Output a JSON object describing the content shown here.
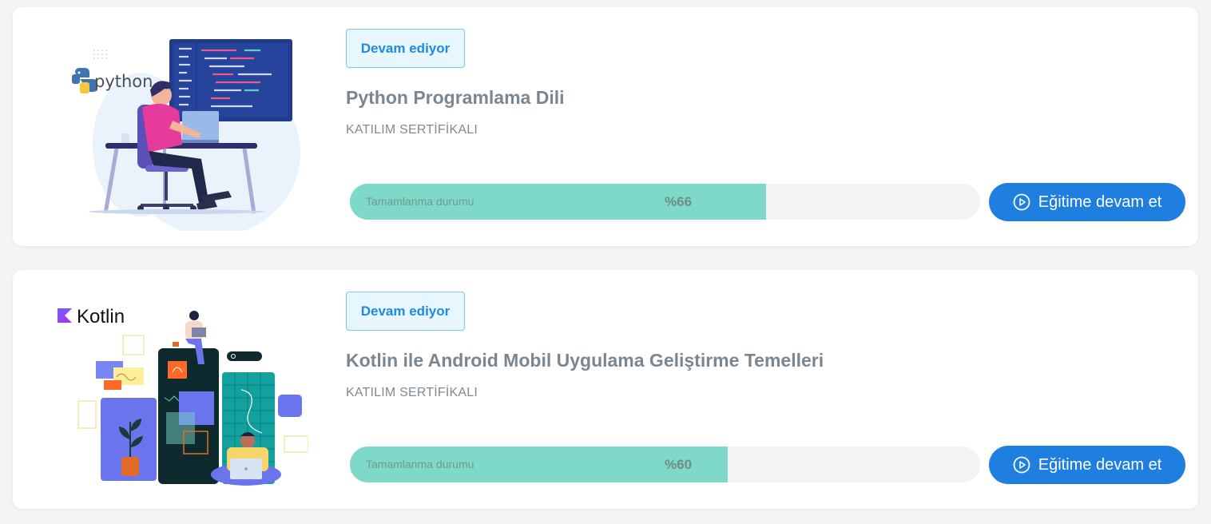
{
  "courses": [
    {
      "status_badge": "Devam ediyor",
      "title": "Python Programlama Dili",
      "certificate": "KATILIM SERTİFİKALI",
      "progress_label": "Tamamlanma durumu",
      "progress_text": "%66",
      "progress_value": 0.66,
      "cta_label": "Eğitime devam et",
      "thumbnail_logo": "python",
      "thumbnail_icon": "python-logo-icon"
    },
    {
      "status_badge": "Devam ediyor",
      "title": "Kotlin ile Android Mobil Uygulama Geliştirme Temelleri",
      "certificate": "KATILIM SERTİFİKALI",
      "progress_label": "Tamamlanma durumu",
      "progress_text": "%60",
      "progress_value": 0.6,
      "cta_label": "Eğitime devam et",
      "thumbnail_logo": "Kotlin",
      "thumbnail_icon": "kotlin-logo-icon"
    }
  ],
  "colors": {
    "badge_text": "#1f8be0",
    "badge_bg": "#e8f6fd",
    "progress_fill": "#7ed9c8",
    "cta_bg": "#1f7fe0"
  }
}
